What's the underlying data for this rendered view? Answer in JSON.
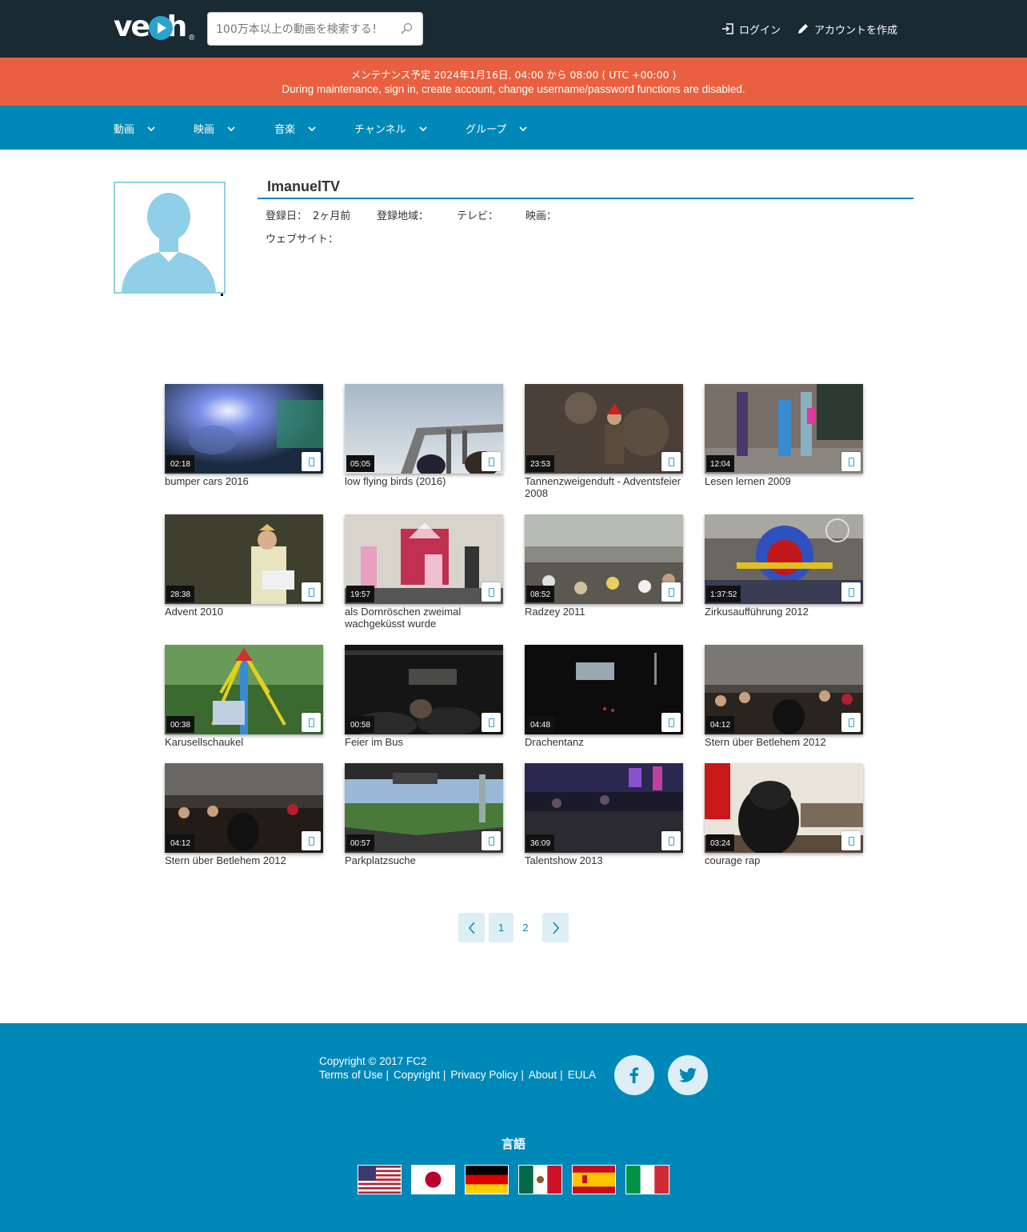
{
  "header": {
    "logo_text": "veoh",
    "logo_reg": "®",
    "search_placeholder": "100万本以上の動画を検索する！",
    "login_label": "ログイン",
    "signup_label": "アカウントを作成"
  },
  "banner": {
    "line1": " メンテナンス予定 2024年1月16日, 04:00 から 08:00 ( UTC +00:00 )",
    "line2": "During maintenance, sign in, create account, change username/password functions are disabled."
  },
  "nav": {
    "items": [
      {
        "label": "動画"
      },
      {
        "label": "映画"
      },
      {
        "label": "音楽"
      },
      {
        "label": "チャンネル"
      },
      {
        "label": "グループ"
      }
    ]
  },
  "profile": {
    "name": "ImanuelTV",
    "registered_label": "登録日：",
    "registered_value": "2ヶ月前",
    "region_label": "登録地域：",
    "tv_label": "テレビ：",
    "movie_label": "映画：",
    "website_label": "ウェブサイト："
  },
  "videos": [
    {
      "title": "bumper cars 2016",
      "duration": "02:18"
    },
    {
      "title": "low flying birds (2016)",
      "duration": "05:05"
    },
    {
      "title": "Tannenzweigenduft - Adventsfeier 2008",
      "duration": "23:53"
    },
    {
      "title": "Lesen lernen 2009",
      "duration": "12:04"
    },
    {
      "title": "Advent 2010",
      "duration": "28:38"
    },
    {
      "title": "als Dornröschen zweimal wachgeküsst wurde",
      "duration": "19:57"
    },
    {
      "title": "Radzey 2011",
      "duration": "08:52"
    },
    {
      "title": "Zirkusaufführung 2012",
      "duration": "1:37:52"
    },
    {
      "title": "Karusellschaukel",
      "duration": "00:38"
    },
    {
      "title": "Feier im Bus",
      "duration": "00:58"
    },
    {
      "title": "Drachentanz",
      "duration": "04:48"
    },
    {
      "title": "Stern über Betlehem 2012",
      "duration": "04:12"
    },
    {
      "title": "Stern über Betlehem 2012",
      "duration": "04:12"
    },
    {
      "title": "Parkplatzsuche",
      "duration": "00:57"
    },
    {
      "title": "Talentshow 2013",
      "duration": "36:09"
    },
    {
      "title": "courage rap",
      "duration": "03:24"
    }
  ],
  "pagination": {
    "pages": [
      "1",
      "2"
    ],
    "current": "1"
  },
  "footer": {
    "copyright": "Copyright © 2017 FC2",
    "links": [
      "Terms of Use",
      "Copyright",
      "Privacy Policy",
      "About",
      "EULA"
    ],
    "separator": "|",
    "language_title": "言語",
    "flags": [
      "us-flag",
      "japan-flag",
      "germany-flag",
      "mexico-flag",
      "spain-flag",
      "italy-flag"
    ]
  },
  "colors": {
    "header_bg": "#1a2a33",
    "banner_bg": "#e86040",
    "brand_blue": "#0088b8",
    "avatar_blue": "#8fd0e8"
  }
}
